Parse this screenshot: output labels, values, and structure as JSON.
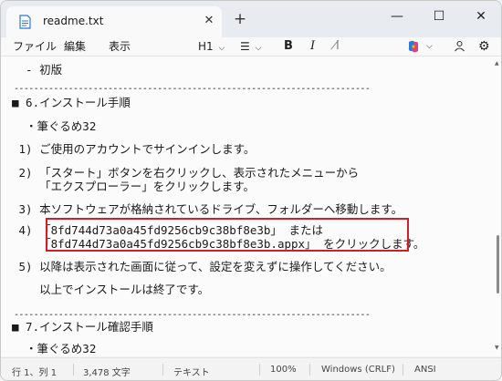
{
  "tab": {
    "title": "readme.txt",
    "close": "✕",
    "new_tab": "+"
  },
  "window_controls": {
    "minimize": "—",
    "maximize": "☐",
    "close": "✕"
  },
  "menu": {
    "file": "ファイル",
    "edit": "編集",
    "view": "表示"
  },
  "toolbar": {
    "heading": "H1",
    "heading_caret": "⌵",
    "list": "☰",
    "list_caret": "⌵",
    "bold": "B",
    "italic": "I",
    "clear_format": "I̸",
    "settings": "⚙"
  },
  "document": {
    "lines": [
      "  - 初版",
      "------------------------------------------------------------------------",
      "■ 6.インストール手順",
      "  ・筆ぐるめ32",
      " 1) ご使用のアカウントでサインインします。",
      " 2) 「スタート」ボタンを右クリックし、表示されたメニューから",
      "    「エクスプローラー」をクリックします。",
      " 3) 本ソフトウェアが格納されているドライブ、フォルダーへ移動します。",
      " 4) 「8fd744d73a0a45fd9256cb9c38bf8e3b」 または",
      "    「8fd744d73a0a45fd9256cb9c38bf8e3b.appx」 をクリックします。",
      " 5) 以降は表示された画面に従って、設定を変えずに操作してください。",
      "    以上でインストールは終了です。",
      "------------------------------------------------------------------------",
      "■ 7.インストール確認手順",
      "  ・筆ぐるめ32"
    ]
  },
  "status": {
    "position": "行 1、列 1",
    "characters": "3,478 文字",
    "format": "テキスト",
    "zoom": "100%",
    "line_ending": "Windows (CRLF)",
    "encoding": "ANSI"
  },
  "colors": {
    "highlight_border": "#d11f2a",
    "accent": "#0067c0"
  }
}
